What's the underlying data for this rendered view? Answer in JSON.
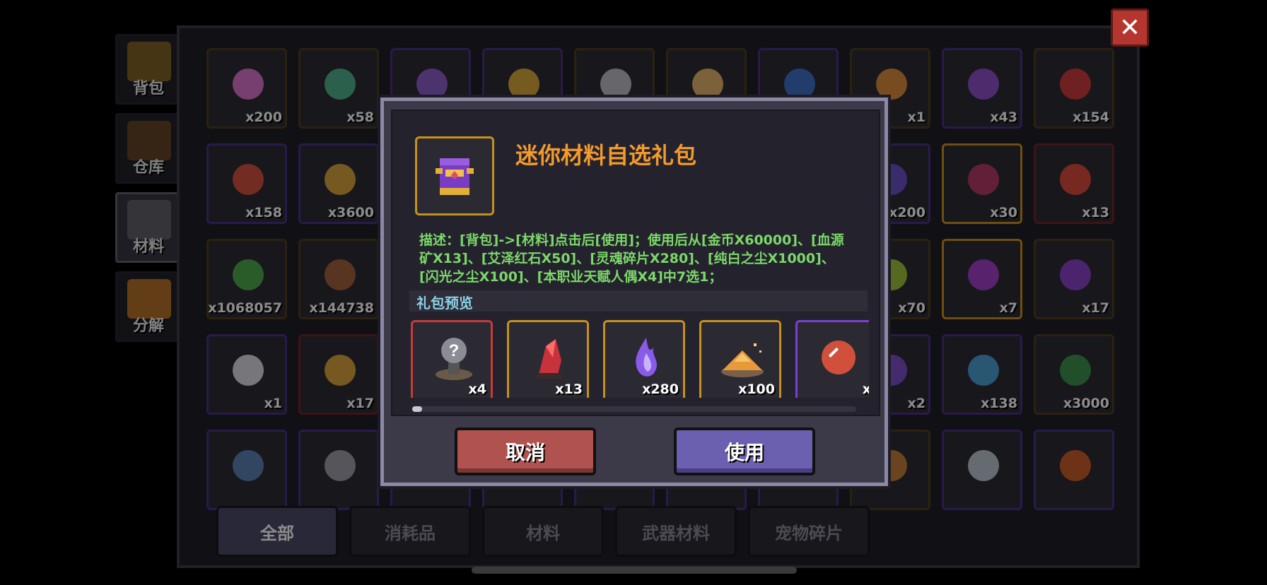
{
  "side_tabs": [
    {
      "label": "背包",
      "icon": "chest-icon",
      "active": false
    },
    {
      "label": "仓库",
      "icon": "warehouse-chest-icon",
      "active": false
    },
    {
      "label": "材料",
      "icon": "material-box-icon",
      "active": true
    },
    {
      "label": "分解",
      "icon": "pumpkin-icon",
      "active": false
    }
  ],
  "inventory": {
    "rows": [
      [
        {
          "qty": "x200",
          "icon": "pink-gem-icon",
          "color": "#d873c9",
          "frame": "gold"
        },
        {
          "qty": "x58",
          "icon": "green-coin-icon",
          "color": "#4fb08a",
          "frame": "gold"
        },
        {
          "qty": "",
          "icon": "purple-rune-icon",
          "color": "#8a5cc6",
          "frame": "purple"
        },
        {
          "qty": "",
          "icon": "gold-coin-icon",
          "color": "#d6a63a",
          "frame": "purple"
        },
        {
          "qty": "",
          "icon": "silver-ore-icon",
          "color": "#b9b9c2",
          "frame": "gold"
        },
        {
          "qty": "",
          "icon": "sand-pile-icon",
          "color": "#e2b36a",
          "frame": "gold"
        },
        {
          "qty": "",
          "icon": "blue-note-icon",
          "color": "#3e6fc4",
          "frame": "purple"
        },
        {
          "qty": "x1",
          "icon": "key-icon",
          "color": "#d98a3a",
          "frame": "gold"
        },
        {
          "qty": "x43",
          "icon": "purple-lock-icon",
          "color": "#8d4fc7",
          "frame": "purple"
        },
        {
          "qty": "x154",
          "icon": "red-crystal-icon",
          "color": "#c93a3a",
          "frame": "gold"
        }
      ],
      [
        {
          "qty": "x158",
          "icon": "red-orb-icon",
          "color": "#d0503c",
          "frame": "purple"
        },
        {
          "qty": "x3600",
          "icon": "medal-icon",
          "color": "#d4a13a",
          "frame": "purple"
        },
        {
          "qty": "",
          "icon": "",
          "color": "#2b2a33",
          "frame": "purple"
        },
        {
          "qty": "",
          "icon": "",
          "color": "#2b2a33",
          "frame": "purple"
        },
        {
          "qty": "",
          "icon": "",
          "color": "#2b2a33",
          "frame": "purple"
        },
        {
          "qty": "",
          "icon": "",
          "color": "#2b2a33",
          "frame": "purple"
        },
        {
          "qty": "",
          "icon": "",
          "color": "#2b2a33",
          "frame": "purple"
        },
        {
          "qty": "x200",
          "icon": "shield-badge-icon",
          "color": "#6a4fc6",
          "frame": "purple"
        },
        {
          "qty": "x30",
          "icon": "monster-face-icon",
          "color": "#b23a66",
          "frame": "orange"
        },
        {
          "qty": "x13",
          "icon": "heart-icon",
          "color": "#d9483c",
          "frame": "red"
        }
      ],
      [
        {
          "qty": "x1068057",
          "icon": "green-slime-coin-icon",
          "color": "#4aa84a",
          "frame": "gold"
        },
        {
          "qty": "x144738",
          "icon": "leather-hide-icon",
          "color": "#a0613a",
          "frame": "gold"
        },
        {
          "qty": "",
          "icon": "",
          "color": "#2b2a33",
          "frame": "purple"
        },
        {
          "qty": "",
          "icon": "",
          "color": "#2b2a33",
          "frame": "purple"
        },
        {
          "qty": "",
          "icon": "",
          "color": "#2b2a33",
          "frame": "purple"
        },
        {
          "qty": "",
          "icon": "",
          "color": "#2b2a33",
          "frame": "purple"
        },
        {
          "qty": "",
          "icon": "",
          "color": "#2b2a33",
          "frame": "purple"
        },
        {
          "qty": "x70",
          "icon": "green-crystal-icon",
          "color": "#9bbf3a",
          "frame": "gold"
        },
        {
          "qty": "x7",
          "icon": "lightning-battery-icon",
          "color": "#a03ec4",
          "frame": "orange"
        },
        {
          "qty": "x17",
          "icon": "gift-book-icon",
          "color": "#8a3fc6",
          "frame": "gold"
        }
      ],
      [
        {
          "qty": "x1",
          "icon": "white-egg-icon",
          "color": "#d9d9e0",
          "frame": "purple"
        },
        {
          "qty": "x17",
          "icon": "gold-trophy-icon",
          "color": "#d6a23a",
          "frame": "red"
        },
        {
          "qty": "",
          "icon": "",
          "color": "#2b2a33",
          "frame": "purple"
        },
        {
          "qty": "",
          "icon": "",
          "color": "#2b2a33",
          "frame": "purple"
        },
        {
          "qty": "",
          "icon": "",
          "color": "#2b2a33",
          "frame": "purple"
        },
        {
          "qty": "",
          "icon": "",
          "color": "#2b2a33",
          "frame": "purple"
        },
        {
          "qty": "",
          "icon": "",
          "color": "#2b2a33",
          "frame": "purple"
        },
        {
          "qty": "x2",
          "icon": "purple-frame-icon",
          "color": "#7b4fc6",
          "frame": "purple"
        },
        {
          "qty": "x138",
          "icon": "rainbow-leaf-icon",
          "color": "#4a9ccf",
          "frame": "purple"
        },
        {
          "qty": "x3000",
          "icon": "green-house-coin-icon",
          "color": "#3a8f4a",
          "frame": "gold"
        }
      ],
      [
        {
          "qty": "",
          "icon": "wand-icon",
          "color": "#5a7fb0",
          "frame": "purple"
        },
        {
          "qty": "",
          "icon": "goggles-icon",
          "color": "#9a9aa6",
          "frame": "purple"
        },
        {
          "qty": "",
          "icon": "",
          "color": "#2b2a33",
          "frame": "purple"
        },
        {
          "qty": "",
          "icon": "",
          "color": "#2b2a33",
          "frame": "purple"
        },
        {
          "qty": "",
          "icon": "",
          "color": "#2b2a33",
          "frame": "purple"
        },
        {
          "qty": "",
          "icon": "",
          "color": "#2b2a33",
          "frame": "purple"
        },
        {
          "qty": "",
          "icon": "",
          "color": "#2b2a33",
          "frame": "purple"
        },
        {
          "qty": "",
          "icon": "bread-icon",
          "color": "#c07a3a",
          "frame": "gold"
        },
        {
          "qty": "",
          "icon": "blob-icon",
          "color": "#b9c3d0",
          "frame": "purple"
        },
        {
          "qty": "",
          "icon": "lantern-icon",
          "color": "#c85a2a",
          "frame": "purple"
        }
      ]
    ]
  },
  "filter_tabs": [
    {
      "label": "全部",
      "active": true
    },
    {
      "label": "消耗品",
      "active": false
    },
    {
      "label": "材料",
      "active": false
    },
    {
      "label": "武器材料",
      "active": false
    },
    {
      "label": "宠物碎片",
      "active": false
    }
  ],
  "close_label": "✕",
  "dialog": {
    "icon": "gift-book-icon",
    "title": "迷你材料自选礼包",
    "description": "描述：[背包]->[材料]点击后[使用]；使用后从[金币X60000]、[血源矿X13]、[艾泽红石X50]、[灵魂碎片X280]、[纯白之尘X1000]、[闪光之尘X100]、[本职业天赋人偶X4]中7选1；",
    "preview_label": "礼包预览",
    "rewards": [
      {
        "qty": "x4",
        "icon": "talent-doll-icon",
        "frame": "red"
      },
      {
        "qty": "x13",
        "icon": "blood-ore-icon",
        "frame": "gold"
      },
      {
        "qty": "x280",
        "icon": "soul-flame-icon",
        "frame": "gold"
      },
      {
        "qty": "x100",
        "icon": "shining-dust-icon",
        "frame": "gold"
      },
      {
        "qty": "x",
        "icon": "red-orb-icon",
        "frame": "purple"
      }
    ],
    "cancel_label": "取消",
    "use_label": "使用"
  },
  "colors": {
    "title": "#f39a2c",
    "description": "#7cd86a",
    "preview_label": "#8ad0e6",
    "cancel_button": "#b05350",
    "use_button": "#6b5fb0",
    "close_button": "#b5362f"
  }
}
